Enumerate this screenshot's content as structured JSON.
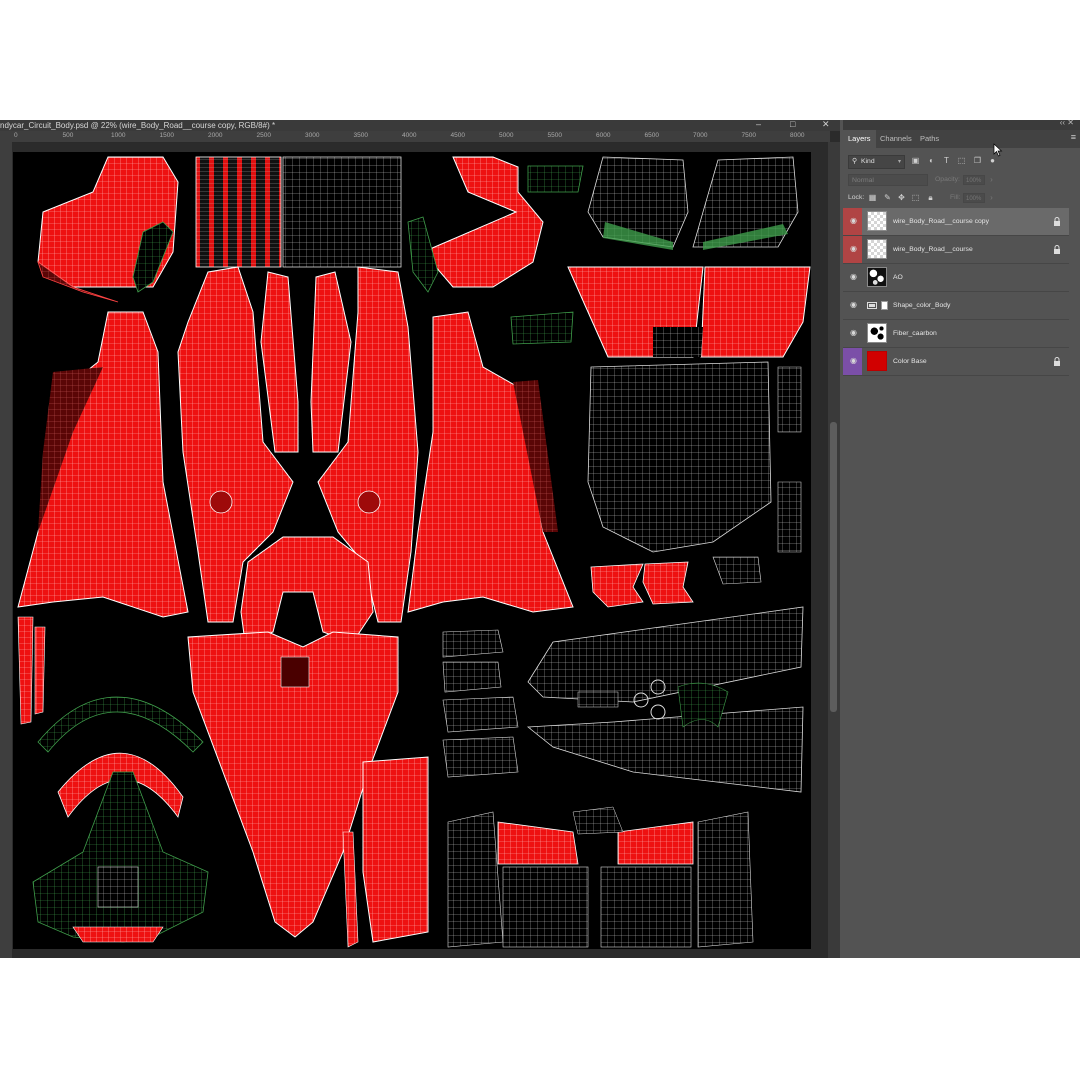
{
  "document": {
    "tab_title": "ndycar_Circuit_Body.psd @ 22% (wire_Body_Road__course copy, RGB/8#) *",
    "ruler_marks": [
      "0",
      "500",
      "1000",
      "1500",
      "2000",
      "2500",
      "3000",
      "3500",
      "4000",
      "4500",
      "5000",
      "5500",
      "6000",
      "6500",
      "7000",
      "7500",
      "8000"
    ]
  },
  "panel": {
    "tabs": [
      {
        "label": "Layers",
        "active": true
      },
      {
        "label": "Channels",
        "active": false
      },
      {
        "label": "Paths",
        "active": false
      }
    ],
    "filter": {
      "label": "Kind"
    },
    "blend_mode": "Normal",
    "opacity_label": "Opacity:",
    "opacity_value": "100%",
    "lock_label": "Lock:",
    "fill_label": "Fill:",
    "fill_value": "100%",
    "layers": [
      {
        "name": "wire_Body_Road__course copy",
        "thumb": "checker",
        "selected": true,
        "swatch": "#b04444",
        "locked": true
      },
      {
        "name": "wire_Body_Road__course",
        "thumb": "checker",
        "selected": false,
        "swatch": "#b04444",
        "locked": true
      },
      {
        "name": "AO",
        "thumb": "ao",
        "selected": false,
        "swatch": "",
        "locked": false
      },
      {
        "name": "Shape_color_Body",
        "thumb": "group",
        "selected": false,
        "swatch": "",
        "locked": false
      },
      {
        "name": "Fiber_caarbon",
        "thumb": "fiber",
        "selected": false,
        "swatch": "",
        "locked": false
      },
      {
        "name": "Color Base",
        "thumb": "red",
        "selected": false,
        "swatch": "#7b4fa8",
        "locked": true
      }
    ]
  },
  "colors": {
    "accent_red": "#ff1a1a",
    "wire": "#ffffff",
    "wire_green": "#3fa34d",
    "bg": "#000000"
  }
}
